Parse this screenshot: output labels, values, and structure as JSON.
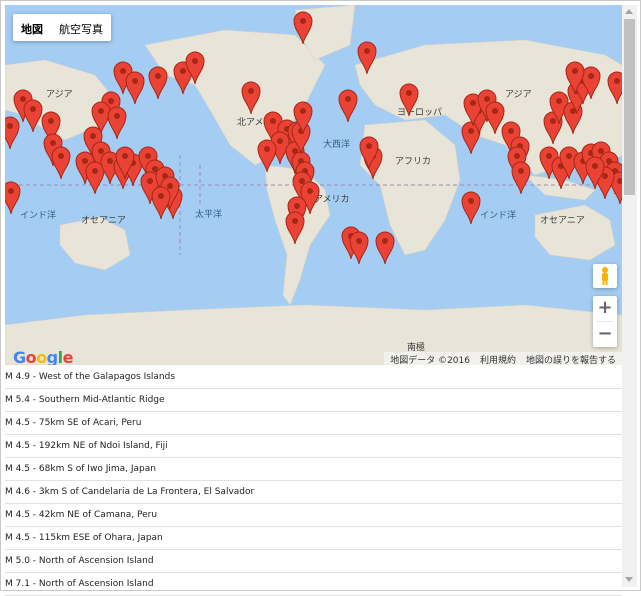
{
  "map": {
    "type_buttons": [
      "地図",
      "航空写真"
    ],
    "selected_type": "地図",
    "labels": {
      "asia_left": "アジア",
      "north_america": "北アメリカ",
      "atlantic": "大西洋",
      "europe": "ヨーロッパ",
      "asia_right": "アジア",
      "africa": "アフリカ",
      "south_america": "南アメリカ",
      "indian_ocean_left": "インド洋",
      "oceania_left": "オセアニア",
      "pacific": "太平洋",
      "indian_ocean_right": "インド洋",
      "oceania_right": "オセアニア",
      "antarctica": "南極"
    },
    "logo": "Google",
    "attribution": {
      "data": "地図データ ©2016",
      "terms": "利用規約",
      "report": "地図の誤りを報告する"
    },
    "zoom_in": "+",
    "zoom_out": "−",
    "colors": {
      "water": "#a5cdf3",
      "land": "#e8e4d8",
      "marker": "#ea4335"
    }
  },
  "earthquakes": [
    "M 4.9 - West of the Galapagos Islands",
    "M 5.4 - Southern Mid-Atlantic Ridge",
    "M 4.5 - 75km SE of Acari, Peru",
    "M 4.5 - 192km NE of Ndoi Island, Fiji",
    "M 4.5 - 68km S of Iwo Jima, Japan",
    "M 4.6 - 3km S of Candelaria de La Frontera, El Salvador",
    "M 4.5 - 42km NE of Camana, Peru",
    "M 4.5 - 115km ESE of Ohara, Japan",
    "M 5.0 - North of Ascension Island",
    "M 7.1 - North of Ascension Island"
  ]
}
